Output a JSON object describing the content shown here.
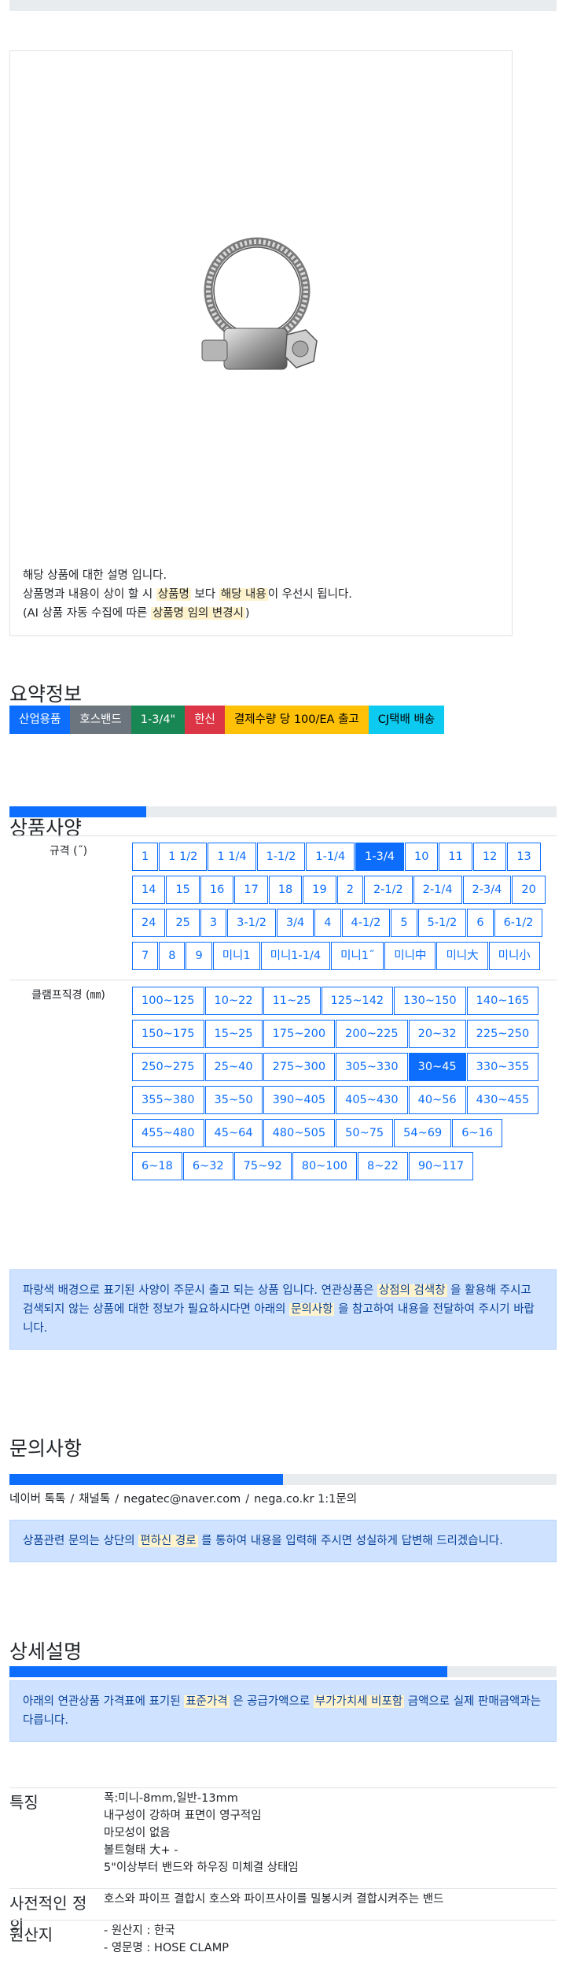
{
  "image_note": {
    "line1": "해당 상품에 대한 설명 입니다.",
    "line2_a": "상품명과 내용이 상이 할 시",
    "line2_hl1": "상품명",
    "line2_b": "보다",
    "line2_hl2": "해당 내용",
    "line2_c": "이 우선시 됩니다.",
    "line3_a": "(AI 상품 자동 수집에 따른",
    "line3_hl": "상품명 임의 변경시",
    "line3_b": ")"
  },
  "summary": {
    "title": "요약정보",
    "badges": [
      {
        "label": "산업용품",
        "color": "#0d6efd",
        "text": "#ffffff"
      },
      {
        "label": "호스밴드",
        "color": "#6c757d",
        "text": "#ffffff"
      },
      {
        "label": "1-3/4\"",
        "color": "#198754",
        "text": "#ffffff"
      },
      {
        "label": "한신",
        "color": "#dc3545",
        "text": "#ffffff"
      },
      {
        "label": "결제수량 당 100/EA 출고",
        "color": "#ffc107",
        "text": "#000000"
      },
      {
        "label": "CJ택배 배송",
        "color": "#0dcaf0",
        "text": "#000000"
      }
    ]
  },
  "spec": {
    "title": "상품사양",
    "progress": 0.25,
    "size_label": "규격 (˝)",
    "sizes": [
      "1",
      "1 1/2",
      "1 1/4",
      "1-1/2",
      "1-1/4",
      "1-3/4",
      "10",
      "11",
      "12",
      "13",
      "14",
      "15",
      "16",
      "17",
      "18",
      "19",
      "2",
      "2-1/2",
      "2-1/4",
      "2-3/4",
      "20",
      "24",
      "25",
      "3",
      "3-1/2",
      "3/4",
      "4",
      "4-1/2",
      "5",
      "5-1/2",
      "6",
      "6-1/2",
      "7",
      "8",
      "9",
      "미니1",
      "미니1-1/4",
      "미니1˝",
      "미니中",
      "미니大",
      "미니小"
    ],
    "size_selected": "1-3/4",
    "range_label": "클램프직경 (㎜)",
    "ranges": [
      "100~125",
      "10~22",
      "11~25",
      "125~142",
      "130~150",
      "140~165",
      "150~175",
      "15~25",
      "175~200",
      "200~225",
      "20~32",
      "225~250",
      "250~275",
      "25~40",
      "275~300",
      "305~330",
      "30~45",
      "330~355",
      "355~380",
      "35~50",
      "390~405",
      "405~430",
      "40~56",
      "430~455",
      "455~480",
      "45~64",
      "480~505",
      "50~75",
      "54~69",
      "6~16",
      "6~18",
      "6~32",
      "75~92",
      "80~100",
      "8~22",
      "90~117"
    ],
    "range_selected": "30~45",
    "notice_a": "파랑색 배경으로 표기된 사양이 주문시 출고 되는 상품 입니다. 연관상품은",
    "notice_hl1": "상점의 검색창",
    "notice_b": "을 활용해 주시고 검색되지 않는 상품에 대한 정보가 필요하시다면 아래의",
    "notice_hl2": "문의사항",
    "notice_c": "을 참고하여 내용을 전달하여 주시기 바랍니다."
  },
  "inquiry": {
    "title": "문의사항",
    "progress": 0.5,
    "contacts": [
      "네이버 톡톡",
      "채널톡",
      "negatec@naver.com",
      "nega.co.kr 1:1문의"
    ],
    "notice_a": "상품관련 문의는 상단의",
    "notice_hl": "편하신 경로",
    "notice_b": "를 통하여 내용을 입력해 주시면 성실하게 답변해 드리겠습니다."
  },
  "detail": {
    "title": "상세설명",
    "progress": 0.8,
    "notice_a": "아래의 연관상품 가격표에 표기된",
    "notice_hl1": "표준가격",
    "notice_b": "은 공급가액으로",
    "notice_hl2": "부가가치세 비포함",
    "notice_c": "금액으로 실제 판매금액과는 다릅니다.",
    "rows": [
      {
        "key": "특징",
        "lines": [
          "폭:미니-8mm,일반-13mm",
          "내구성이 강하며 표면이 영구적임",
          "마모성이 없음",
          "볼트형태 大+ -",
          "5\"이상부터 밴드와 하우징 미체결 상태임"
        ]
      },
      {
        "key": "사전적인 정의",
        "lines": [
          "호스와 파이프 결합시 호스와 파이프사이를 밀봉시켜 결합시켜주는 밴드"
        ]
      },
      {
        "key": "원산지",
        "lines": [
          "- 원산지 : 한국",
          "- 영문명 : HOSE CLAMP"
        ]
      }
    ]
  }
}
